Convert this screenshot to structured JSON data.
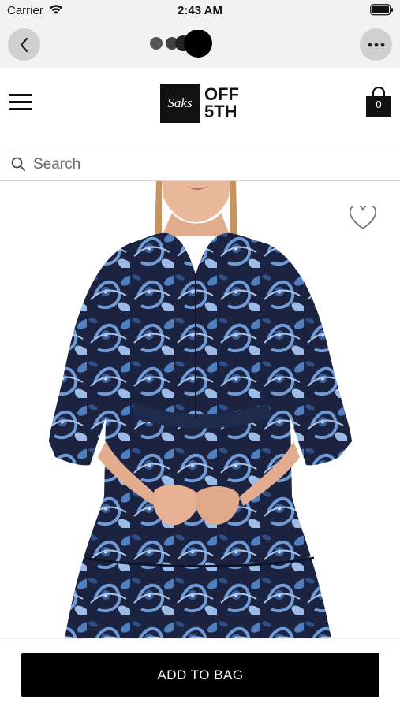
{
  "status_bar": {
    "carrier": "Carrier",
    "time": "2:43 AM",
    "wifi_icon": "wifi-icon",
    "battery_icon": "battery-icon"
  },
  "browser_bar": {
    "back_icon": "chevron-left-icon",
    "more_icon": "more-horizontal-icon",
    "loading_icon": "loading-dots-icon"
  },
  "header": {
    "menu_icon": "hamburger-menu-icon",
    "logo": {
      "script": "Saks",
      "line1": "OFF",
      "line2": "5TH"
    },
    "bag_count": "0"
  },
  "search": {
    "placeholder": "Search"
  },
  "product": {
    "image_icon": "product-photo",
    "wishlist_icon": "heart-icon"
  },
  "bottom_bar": {
    "add_to_bag_label": "ADD TO BAG"
  },
  "colors": {
    "accent": "#000000",
    "chrome_bg": "#f2f2f2",
    "dress_navy": "#1b2340",
    "dress_blue": "#4f7fbf"
  }
}
